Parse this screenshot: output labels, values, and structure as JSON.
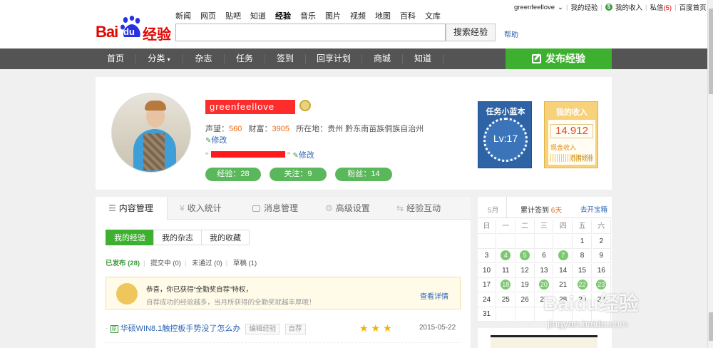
{
  "top_nav": [
    "新闻",
    "网页",
    "贴吧",
    "知道",
    "经验",
    "音乐",
    "图片",
    "视频",
    "地图",
    "百科",
    "文库"
  ],
  "logo": {
    "bai": "Bai",
    "du": "du",
    "jingyan": "经验"
  },
  "search": {
    "value": "",
    "button": "搜索经验",
    "help": "帮助"
  },
  "userbar": {
    "username": "greenfeellove",
    "my_jingyan": "我的经验",
    "my_income": "我的收入",
    "messages": "私信",
    "message_count": "(5)",
    "home": "百度首页"
  },
  "main_nav": [
    "首页",
    "分类",
    "杂志",
    "任务",
    "签到",
    "回享计划",
    "商城",
    "知道"
  ],
  "publish": "发布经验",
  "profile": {
    "username": "greenfeellove",
    "shengwang_label": "声望：",
    "shengwang": "560",
    "caifu_label": "财富：",
    "caifu": "3905",
    "location_label": "所在地：",
    "location": "贵州 黔东南苗族侗族自治州",
    "modify": "修改",
    "pills": [
      "经验：28",
      "关注：9",
      "粉丝：14"
    ],
    "task_title": "任务小蓝本",
    "level": "Lv:17",
    "income_title": "我的收入",
    "income_amount": "14.912",
    "cash_label": "现金收入",
    "bar_label": "百度经验"
  },
  "tabs": [
    "内容管理",
    "收入统计",
    "消息管理",
    "高级设置",
    "经验互动"
  ],
  "subtabs": [
    "我的经验",
    "我的杂志",
    "我的收藏"
  ],
  "filters": {
    "published": "已发布 (28)",
    "pending": "提交中 (0)",
    "rejected": "未通过 (0)",
    "draft": "草稿 (1)"
  },
  "notice": {
    "line1": "恭喜，你已获得“全勤奖自荐”特权，",
    "line2": "自荐成功的经验越多，当月所获得的全勤奖就越丰厚哦！",
    "more": "查看详情"
  },
  "article": {
    "tag": "原",
    "title": "华硕WIN8.1触控板手势没了怎么办",
    "edit": "编辑经验",
    "recommend": "自荐",
    "stars": "★★★",
    "date": "2015-05-22"
  },
  "calendar": {
    "month": "5月",
    "signin_text": "累计签到",
    "signin_days": "6天",
    "treasure": "去开宝箱",
    "weekdays": [
      "日",
      "一",
      "二",
      "三",
      "四",
      "五",
      "六"
    ],
    "rows": [
      [
        "",
        "",
        "",
        "",
        "",
        "1",
        "2"
      ],
      [
        "3",
        "4",
        "5",
        "6",
        "7",
        "8",
        "9"
      ],
      [
        "10",
        "11",
        "12",
        "13",
        "14",
        "15",
        "16"
      ],
      [
        "17",
        "18",
        "19",
        "20",
        "21",
        "22",
        "23"
      ],
      [
        "24",
        "25",
        "26",
        "27",
        "28",
        "29",
        "30"
      ],
      [
        "31",
        "",
        "",
        "",
        "",
        "",
        ""
      ]
    ],
    "checked": [
      "4",
      "5",
      "7",
      "18",
      "20",
      "22",
      "23"
    ]
  },
  "watermark": {
    "logo": "Baidu经验",
    "url": "jingyan.baidu.com"
  }
}
